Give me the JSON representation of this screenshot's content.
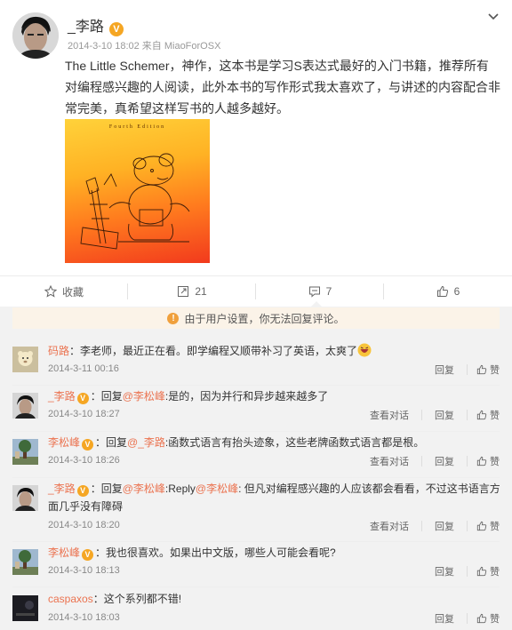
{
  "post": {
    "author": "_李路",
    "verified_badge": "V",
    "meta": "2014-3-10 18:02 来自 MiaoForOSX",
    "text": "The Little Schemer，神作，这本书是学习S表达式最好的入门书籍，推荐所有对编程感兴趣的人阅读，此外本书的写作形式我太喜欢了，与讲述的内容配合非常完美，真希望这样写书的人越多越好。",
    "cover_title": "Fourth Edition"
  },
  "actions": {
    "favorite": "收藏",
    "repost": "21",
    "comment": "7",
    "like": "6"
  },
  "notice": "由于用户设置，你无法回复评论。",
  "labels": {
    "reply": "回复",
    "like": "赞",
    "view_conversation": "查看对话"
  },
  "comments": [
    {
      "name": "码路",
      "sep": "：",
      "text": "李老师，最近正在看。即学编程又顺带补习了英语，太爽了",
      "time": "2014-3-11 00:16"
    },
    {
      "name": "_李路",
      "badge": "V",
      "sep": "：",
      "prefix": "回复",
      "at": "@李松峰",
      "text": ":是的，因为并行和异步越来越多了",
      "time": "2014-3-10 18:27"
    },
    {
      "name": "李松峰",
      "badge": "V",
      "sep": "：",
      "prefix": "回复",
      "at": "@_李路",
      "text": ":函数式语言有抬头迹象，这些老牌函数式语言都是根。",
      "time": "2014-3-10 18:26"
    },
    {
      "name": "_李路",
      "badge": "V",
      "sep": "：",
      "prefix": "回复",
      "at": "@李松峰",
      "mid": ":Reply",
      "at2": "@李松峰",
      "text": ": 但凡对编程感兴趣的人应该都会看看，不过这书语言方面几乎没有障碍",
      "time": "2014-3-10 18:20"
    },
    {
      "name": "李松峰",
      "badge": "V",
      "sep": "：",
      "text": "我也很喜欢。如果出中文版，哪些人可能会看呢?",
      "time": "2014-3-10 18:13"
    },
    {
      "name": "caspaxos",
      "sep": "：",
      "text": "这个系列都不错!",
      "time": "2014-3-10 18:03"
    }
  ]
}
